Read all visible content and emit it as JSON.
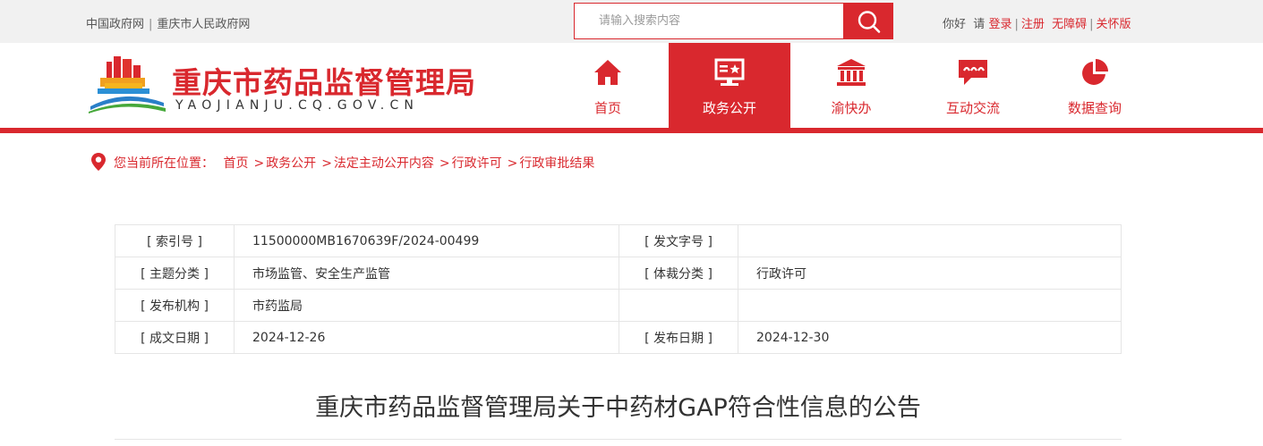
{
  "topbar": {
    "links": [
      "中国政府网",
      "重庆市人民政府网"
    ],
    "separator": "|",
    "search_placeholder": "请输入搜索内容",
    "greeting": "你好",
    "please": "请",
    "login": "登录",
    "register": "注册",
    "accessibility": "无障碍",
    "elder_mode": "关怀版"
  },
  "header": {
    "site_title": "重庆市药品监督管理局",
    "site_domain": "YAOJIANJU.CQ.GOV.CN",
    "nav": [
      {
        "label": "首页",
        "icon": "home-icon"
      },
      {
        "label": "政务公开",
        "icon": "monitor-star-icon",
        "active": true
      },
      {
        "label": "渝快办",
        "icon": "government-building-icon"
      },
      {
        "label": "互动交流",
        "icon": "chat-bubble-icon"
      },
      {
        "label": "数据查询",
        "icon": "pie-chart-icon"
      }
    ]
  },
  "breadcrumb": {
    "prefix": "您当前所在位置：",
    "items": [
      "首页",
      "政务公开",
      "法定主动公开内容",
      "行政许可",
      "行政审批结果"
    ],
    "separator": ">"
  },
  "meta": {
    "rows": [
      {
        "k1": "[ 索引号 ]",
        "v1": "11500000MB1670639F/2024-00499",
        "k2": "[ 发文字号 ]",
        "v2": ""
      },
      {
        "k1": "[ 主题分类 ]",
        "v1": "市场监管、安全生产监管",
        "k2": "[ 体裁分类 ]",
        "v2": "行政许可"
      },
      {
        "k1": "[ 发布机构 ]",
        "v1": "市药监局",
        "k2": "",
        "v2": ""
      },
      {
        "k1": "[ 成文日期 ]",
        "v1": "2024-12-26",
        "k2": "[ 发布日期 ]",
        "v2": "2024-12-30"
      }
    ]
  },
  "article": {
    "title": "重庆市药品监督管理局关于中药材GAP符合性信息的公告"
  },
  "colors": {
    "brand_red": "#d9282e",
    "topbar_bg": "#f1f1f1"
  }
}
